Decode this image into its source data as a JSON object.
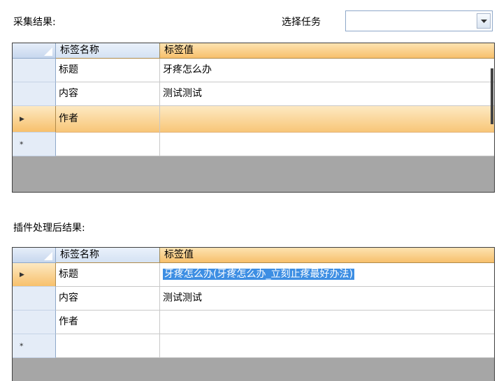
{
  "top": {
    "result_label": "采集结果:",
    "task_label": "选择任务",
    "task_value": ""
  },
  "grid1": {
    "headers": [
      "标签名称",
      "标签值"
    ],
    "rows": [
      {
        "name": "标题",
        "value": "牙疼怎么办"
      },
      {
        "name": "内容",
        "value": "测试测试"
      },
      {
        "name": "作者",
        "value": ""
      },
      {
        "name": "",
        "value": ""
      }
    ],
    "current_row": 3,
    "new_row_marker": "*"
  },
  "bottom": {
    "result_label": "插件处理后结果:"
  },
  "grid2": {
    "headers": [
      "标签名称",
      "标签值"
    ],
    "rows": [
      {
        "name": "标题",
        "value": "牙疼怎么办(牙疼怎么办_立刻止疼最好办法)"
      },
      {
        "name": "内容",
        "value": "测试测试"
      },
      {
        "name": "作者",
        "value": ""
      },
      {
        "name": "",
        "value": ""
      }
    ],
    "current_row": 1,
    "selected_cell": "value",
    "new_row_marker": "*"
  }
}
